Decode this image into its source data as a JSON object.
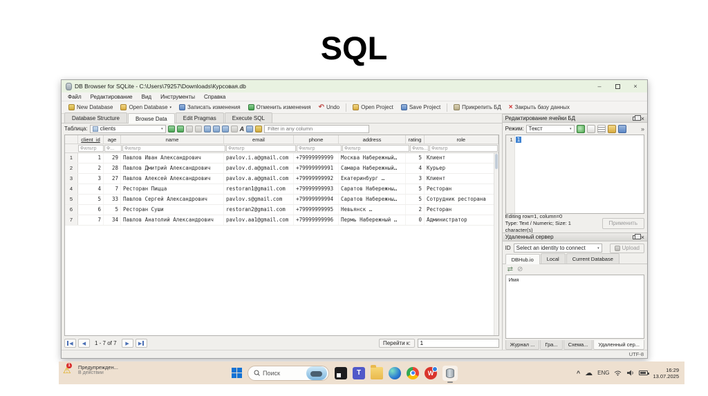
{
  "slide": {
    "title": "SQL"
  },
  "glyphs": {
    "dropdown": "▾",
    "overflow": "»",
    "prev": "◀",
    "next": "▶",
    "close": "×",
    "minimize": "–",
    "undo_arrow": "↶",
    "close_db": "×",
    "refresh": "⇄",
    "stop": "⊘",
    "chevron_up": "^",
    "cloud": "☁",
    "warning": "⚠"
  },
  "window": {
    "title": "DB Browser for SQLite - C:\\Users\\79257\\Downloads\\Курсовая.db",
    "menu": [
      "Файл",
      "Редактирование",
      "Вид",
      "Инструменты",
      "Справка"
    ],
    "toolbar": [
      "New Database",
      "Open Database",
      "Записать изменения",
      "Отменить изменения",
      "Undo",
      "Open Project",
      "Save Project",
      "Прикрепить БД",
      "Закрыть базу данных"
    ],
    "tabs": [
      "Database Structure",
      "Browse Data",
      "Edit Pragmas",
      "Execute SQL"
    ]
  },
  "browse": {
    "table_label": "Таблица:",
    "table_name": "clients",
    "filter_placeholder": "Filter in any column",
    "columns": [
      "client_id",
      "age",
      "name",
      "email",
      "phone",
      "address",
      "rating",
      "role"
    ],
    "filters": [
      "Фильтр",
      "Ф...",
      "Фильтр",
      "Фильтр",
      "Фильтр",
      "Фильтр",
      "Филь...",
      "Фильтр"
    ],
    "rows": [
      [
        "1",
        "29",
        "Павлов Иван Александрович",
        "pavlov.i.a@gmail.com",
        "+79999999999",
        "Москва Набережный…",
        "5",
        "Клиент"
      ],
      [
        "2",
        "28",
        "Павлов Дмитрий Александрович",
        "pavlov.d.a@gmail.com",
        "+79999999991",
        "Самара Набережный…",
        "4",
        "Курьер"
      ],
      [
        "3",
        "27",
        "Павлов Алексей Александрович",
        "pavlov.a.a@gmail.com",
        "+79999999992",
        "Екатеринбург …",
        "3",
        "Клиент"
      ],
      [
        "4",
        "7",
        "Ресторан Пицца",
        "restoran1@gmail.com",
        "+79999999993",
        "Саратов Набережны…",
        "5",
        "Ресторан"
      ],
      [
        "5",
        "33",
        "Павлов Сергей Александрович",
        "pavlov.s@gmail.com",
        "+79999999994",
        "Саратов Набережны…",
        "5",
        "Сотрудник ресторана"
      ],
      [
        "6",
        "5",
        "Ресторан Суши",
        "restoran2@gmail.com",
        "+79999999995",
        "Невьянск …",
        "2",
        "Ресторан"
      ],
      [
        "7",
        "34",
        "Павлов Анатолий Александрович",
        "pavlov.aa1@gmail.com",
        "+79999999996",
        "Пермь Набережный …",
        "0",
        "Администратор"
      ]
    ],
    "nav": {
      "range": "1 - 7 of 7",
      "goto_label": "Перейти к:",
      "goto_value": "1"
    }
  },
  "cell_editor": {
    "title": "Редактирование ячейки БД",
    "mode_label": "Режим:",
    "mode_value": "Текст",
    "line_number": "1",
    "cell_value": "1",
    "status_line1": "Editing row=1, column=0",
    "status_line2": "Type: Text / Numeric; Size: 1 character(s)",
    "apply_label": "Применить"
  },
  "remote": {
    "title": "Удаленный сервер",
    "id_label": "ID",
    "identity_value": "Select an identity to connect",
    "upload_label": "Upload",
    "tabs": [
      "DBHub.io",
      "Local",
      "Current Database"
    ],
    "list_header": "Имя",
    "bottom_tabs": [
      "Журнал ...",
      "Гра...",
      "Схема...",
      "Удаленный сер..."
    ]
  },
  "statusbar": {
    "encoding": "UTF-8"
  },
  "taskbar": {
    "notification": {
      "title": "Предупрежден...",
      "subtitle": "В действии",
      "badge": "1"
    },
    "search_placeholder": "Поиск",
    "w_letter": "W",
    "teams_letter": "T",
    "tray": {
      "lang": "ENG",
      "time": "16:29",
      "date": "13.07.2025"
    }
  }
}
